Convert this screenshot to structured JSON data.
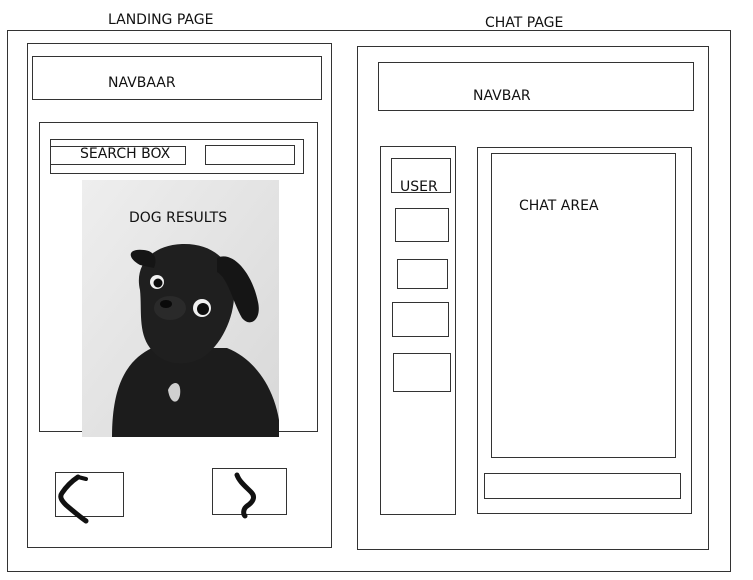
{
  "landing": {
    "page_title": "LANDING PAGE",
    "navbar_label": "NAVBAAR",
    "search_label": "SEARCH BOX",
    "results_label": "DOG RESULTS",
    "prev_icon": "chevron-left-icon",
    "next_icon": "chevron-right-icon"
  },
  "chat": {
    "page_title": "CHAT PAGE",
    "navbar_label": "NAVBAR",
    "user_label": "USER",
    "chat_area_label": "CHAT AREA"
  },
  "colors": {
    "line": "#333333",
    "photo_bg": "#e9e9e9",
    "dog": "#1c1c1c"
  }
}
